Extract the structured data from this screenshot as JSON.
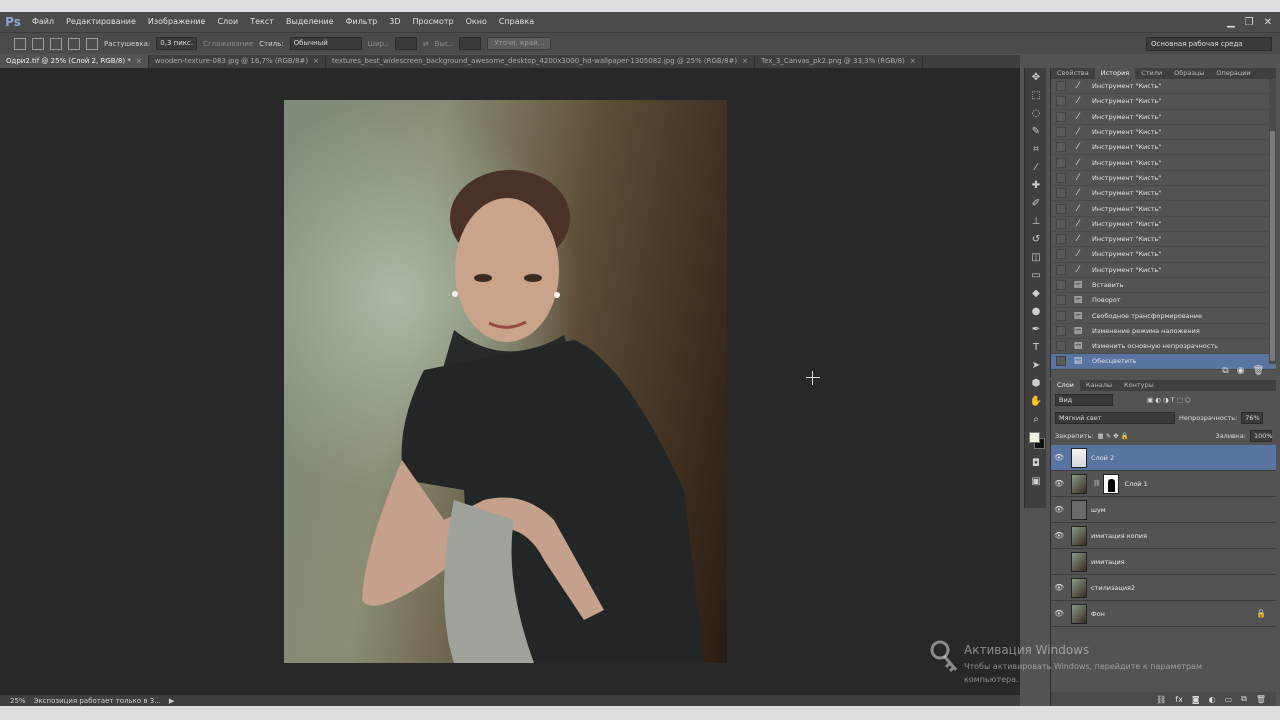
{
  "app": {
    "logo": "Ps"
  },
  "menu": [
    "Файл",
    "Редактирование",
    "Изображение",
    "Слои",
    "Текст",
    "Выделение",
    "Фильтр",
    "3D",
    "Просмотр",
    "Окно",
    "Справка"
  ],
  "window_controls": {
    "minimize": "▁",
    "restore": "❐",
    "close": "✕"
  },
  "options": {
    "feather_label": "Растушевка:",
    "feather_value": "0,3 пикс.",
    "smoothing_label": "Сглаживание",
    "style_label": "Стиль:",
    "style_value": "Обычный",
    "width_label": "Шир.:",
    "height_label": "Выс.:",
    "refine_button": "Уточн. край...",
    "workspace": "Основная рабочая среда"
  },
  "tabs": [
    {
      "label": "Одри2.tif @ 25% (Слой 2, RGB/8) *",
      "active": true
    },
    {
      "label": "wooden-texture-083.jpg @ 16,7% (RGB/8#)",
      "active": false
    },
    {
      "label": "textures_best_widescreen_background_awesome_desktop_4200x3000_hd-wallpaper-1305082.jpg @ 25% (RGB/8#)",
      "active": false
    },
    {
      "label": "Tex_3_Canvas_pk2.png @ 33,3% (RGB/8)",
      "active": false
    }
  ],
  "tab_close": "×",
  "status": {
    "zoom": "25%",
    "message": "Экспозиция работает только в 3..."
  },
  "history_panel": {
    "tabs": [
      "Свойства",
      "История",
      "Стили",
      "Образцы",
      "Операции"
    ],
    "active_tab": 1,
    "items": [
      "Инструмент \"Кисть\"",
      "Инструмент \"Кисть\"",
      "Инструмент \"Кисть\"",
      "Инструмент \"Кисть\"",
      "Инструмент \"Кисть\"",
      "Инструмент \"Кисть\"",
      "Инструмент \"Кисть\"",
      "Инструмент \"Кисть\"",
      "Инструмент \"Кисть\"",
      "Инструмент \"Кисть\"",
      "Инструмент \"Кисть\"",
      "Инструмент \"Кисть\"",
      "Инструмент \"Кисть\"",
      "Вставить",
      "Поворот",
      "Свободное трансформирование",
      "Изменение режима наложения",
      "Изменить основную непрозрачность",
      "Обесцветить"
    ],
    "selected_item": "Обесцветить"
  },
  "layers_panel": {
    "tabs": [
      "Слои",
      "Каналы",
      "Контуры"
    ],
    "filter_kind": "Вид",
    "blend_mode": "Мягкий свет",
    "opacity_label": "Непрозрачность:",
    "opacity_value": "76%",
    "lock_label": "Закрепить:",
    "fill_label": "Заливка:",
    "fill_value": "100%",
    "layers": [
      {
        "name": "Слой 2",
        "visible": true,
        "selected": true,
        "thumb": "white"
      },
      {
        "name": "Слой 1",
        "visible": true,
        "selected": false,
        "thumb": "photo",
        "mask": true
      },
      {
        "name": "шум",
        "visible": true,
        "selected": false,
        "thumb": "gray"
      },
      {
        "name": "имитация копия",
        "visible": true,
        "selected": false,
        "thumb": "photo"
      },
      {
        "name": "имитация",
        "visible": false,
        "selected": false,
        "thumb": "photo"
      },
      {
        "name": "стилизация2",
        "visible": true,
        "selected": false,
        "thumb": "photo"
      },
      {
        "name": "Фон",
        "visible": true,
        "selected": false,
        "thumb": "photo",
        "locked": true
      }
    ]
  },
  "watermark": {
    "title": "Активация Windows",
    "subtitle": "Чтобы активировать Windows, перейдите к параметрам компьютера."
  }
}
